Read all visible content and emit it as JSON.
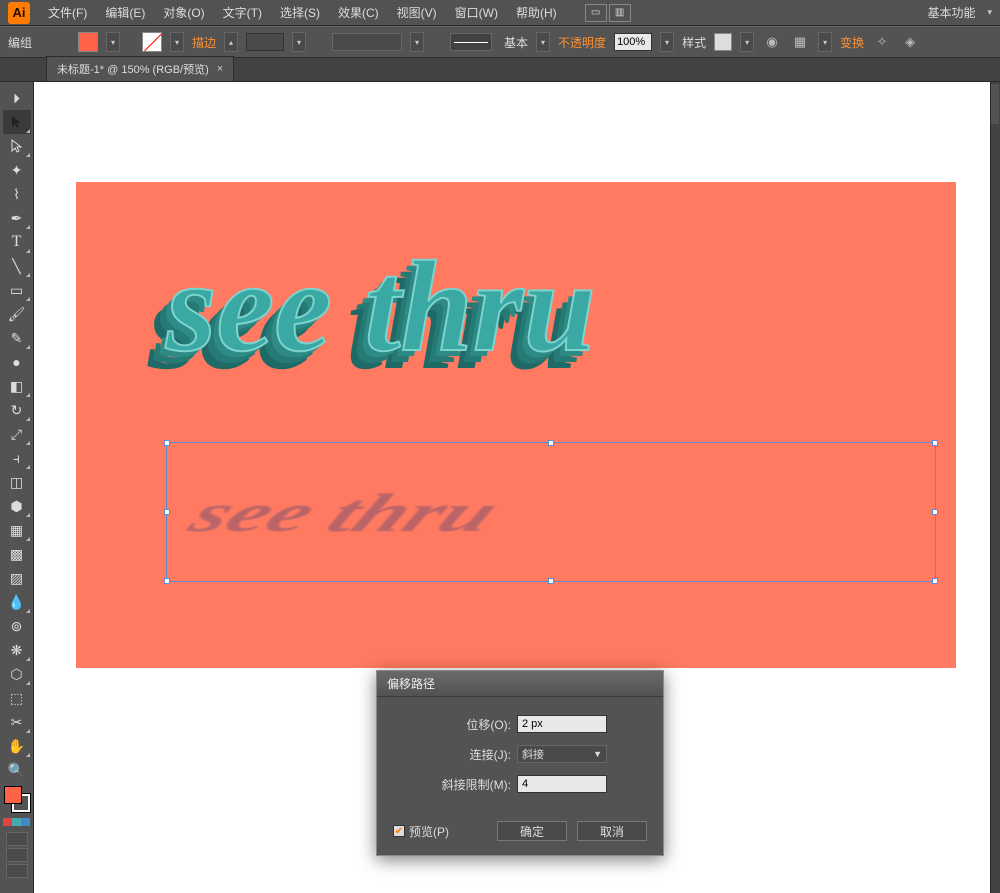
{
  "app": {
    "logo": "Ai"
  },
  "menu": {
    "items": [
      "文件(F)",
      "编辑(E)",
      "对象(O)",
      "文字(T)",
      "选择(S)",
      "效果(C)",
      "视图(V)",
      "窗口(W)",
      "帮助(H)"
    ],
    "workspace": "基本功能"
  },
  "control": {
    "group_label": "编组",
    "stroke_label": "描边",
    "stroke_profile": "基本",
    "opacity_label": "不透明度",
    "opacity_value": "100%",
    "style_label": "样式",
    "transform_label": "变换"
  },
  "tab": {
    "title": "未标题-1* @ 150% (RGB/预览)"
  },
  "artwork": {
    "main_text": "see thru",
    "shadow_text": "see thru"
  },
  "dialog": {
    "title": "偏移路径",
    "offset_label": "位移(O):",
    "offset_value": "2 px",
    "join_label": "连接(J):",
    "join_value": "斜接",
    "miter_label": "斜接限制(M):",
    "miter_value": "4",
    "preview_label": "预览(P)",
    "ok": "确定",
    "cancel": "取消"
  },
  "tools": [
    "select",
    "direct",
    "wand",
    "lasso",
    "pen",
    "type",
    "line",
    "rect",
    "brush",
    "pencil",
    "blob",
    "eraser",
    "rotate",
    "scale",
    "width",
    "freetrans",
    "shapebuild",
    "persp",
    "mesh",
    "gradient",
    "eyedrop",
    "blend",
    "symbol",
    "graph",
    "artboard",
    "slice",
    "hand",
    "zoom"
  ]
}
